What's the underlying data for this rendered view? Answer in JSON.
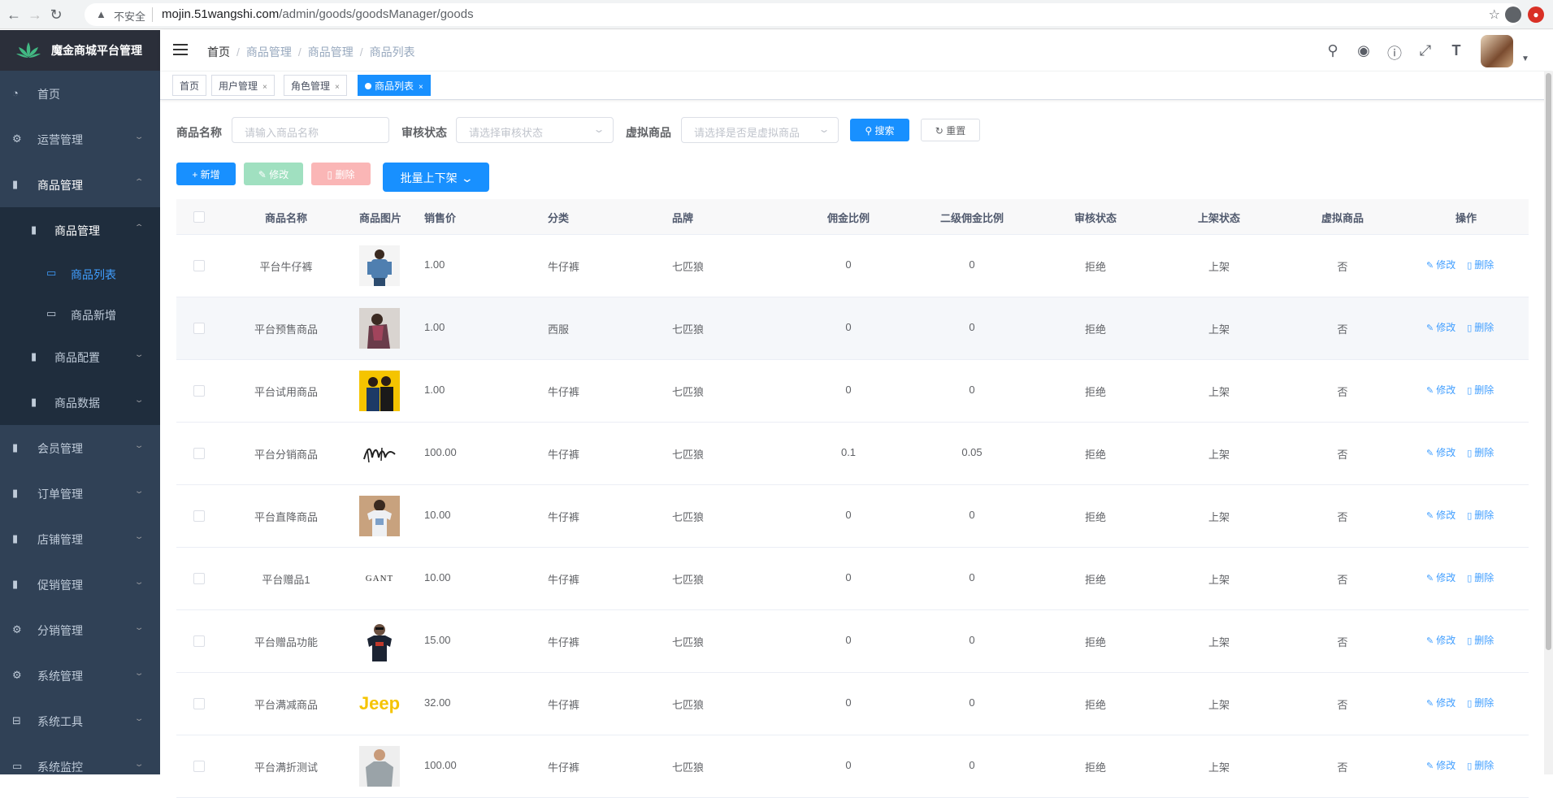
{
  "browser": {
    "security": "不安全",
    "url_host": "mojin.51wangshi.com",
    "url_path": "/admin/goods/goodsManager/goods"
  },
  "app": {
    "title": "魔金商城平台管理"
  },
  "sidebar": {
    "items": [
      {
        "label": "首页",
        "icon": "dashboard-icon"
      },
      {
        "label": "运营管理",
        "icon": "gear-icon"
      },
      {
        "label": "商品管理",
        "icon": "folder-icon"
      },
      {
        "label": "商品管理",
        "icon": "folder-icon"
      },
      {
        "label": "商品列表",
        "icon": "monitor-icon"
      },
      {
        "label": "商品新增",
        "icon": "monitor-icon"
      },
      {
        "label": "商品配置",
        "icon": "folder-icon"
      },
      {
        "label": "商品数据",
        "icon": "folder-icon"
      },
      {
        "label": "会员管理",
        "icon": "folder-icon"
      },
      {
        "label": "订单管理",
        "icon": "folder-icon"
      },
      {
        "label": "店铺管理",
        "icon": "folder-icon"
      },
      {
        "label": "促销管理",
        "icon": "folder-icon"
      },
      {
        "label": "分销管理",
        "icon": "gear-icon"
      },
      {
        "label": "系统管理",
        "icon": "gear-icon"
      },
      {
        "label": "系统工具",
        "icon": "toolbox-icon"
      },
      {
        "label": "系统监控",
        "icon": "monitor-icon"
      }
    ]
  },
  "breadcrumb": [
    "首页",
    "商品管理",
    "商品管理",
    "商品列表"
  ],
  "tabs": [
    {
      "label": "首页"
    },
    {
      "label": "用户管理"
    },
    {
      "label": "角色管理"
    },
    {
      "label": "商品列表"
    }
  ],
  "search": {
    "name_label": "商品名称",
    "name_placeholder": "请输入商品名称",
    "audit_label": "审核状态",
    "audit_placeholder": "请选择审核状态",
    "virtual_label": "虚拟商品",
    "virtual_placeholder": "请选择是否是虚拟商品",
    "search_btn": "搜索",
    "reset_btn": "重置"
  },
  "toolbar": {
    "add": "新增",
    "edit": "修改",
    "delete": "删除",
    "batch": "批量上下架"
  },
  "table": {
    "headers": [
      "商品名称",
      "商品图片",
      "销售价",
      "分类",
      "品牌",
      "佣金比例",
      "二级佣金比例",
      "审核状态",
      "上架状态",
      "虚拟商品",
      "操作"
    ],
    "edit_label": "修改",
    "delete_label": "删除",
    "rows": [
      {
        "name": "平台牛仔裤",
        "price": "1.00",
        "category": "牛仔裤",
        "brand": "七匹狼",
        "commission": "0",
        "commission2": "0",
        "audit": "拒绝",
        "shelf": "上架",
        "virtual": "否",
        "image": "jeans-person-photo"
      },
      {
        "name": "平台预售商品",
        "price": "1.00",
        "category": "西服",
        "brand": "七匹狼",
        "commission": "0",
        "commission2": "0",
        "audit": "拒绝",
        "shelf": "上架",
        "virtual": "否",
        "image": "scarf-person-photo"
      },
      {
        "name": "平台试用商品",
        "price": "1.00",
        "category": "牛仔裤",
        "brand": "七匹狼",
        "commission": "0",
        "commission2": "0",
        "audit": "拒绝",
        "shelf": "上架",
        "virtual": "否",
        "image": "yellow-background-photo"
      },
      {
        "name": "平台分销商品",
        "price": "100.00",
        "category": "牛仔裤",
        "brand": "七匹狼",
        "commission": "0.1",
        "commission2": "0.05",
        "audit": "拒绝",
        "shelf": "上架",
        "virtual": "否",
        "image": "handwritten-logo"
      },
      {
        "name": "平台直降商品",
        "price": "10.00",
        "category": "牛仔裤",
        "brand": "七匹狼",
        "commission": "0",
        "commission2": "0",
        "audit": "拒绝",
        "shelf": "上架",
        "virtual": "否",
        "image": "tshirt-person-photo"
      },
      {
        "name": "平台赠品1",
        "price": "10.00",
        "category": "牛仔裤",
        "brand": "七匹狼",
        "commission": "0",
        "commission2": "0",
        "audit": "拒绝",
        "shelf": "上架",
        "virtual": "否",
        "image": "gant-logo",
        "logo_text": "GANT"
      },
      {
        "name": "平台赠品功能",
        "price": "15.00",
        "category": "牛仔裤",
        "brand": "七匹狼",
        "commission": "0",
        "commission2": "0",
        "audit": "拒绝",
        "shelf": "上架",
        "virtual": "否",
        "image": "dark-tshirt-person-photo"
      },
      {
        "name": "平台满减商品",
        "price": "32.00",
        "category": "牛仔裤",
        "brand": "七匹狼",
        "commission": "0",
        "commission2": "0",
        "audit": "拒绝",
        "shelf": "上架",
        "virtual": "否",
        "image": "jeep-logo",
        "logo_text": "Jeep"
      },
      {
        "name": "平台满折测试",
        "price": "100.00",
        "category": "牛仔裤",
        "brand": "七匹狼",
        "commission": "0",
        "commission2": "0",
        "audit": "拒绝",
        "shelf": "上架",
        "virtual": "否",
        "image": "sweater-person-photo"
      }
    ]
  },
  "colors": {
    "sidebar_bg": "#304156",
    "submenu_bg": "#1f2d3d",
    "primary": "#1890ff",
    "active_menu": "#409eff"
  }
}
